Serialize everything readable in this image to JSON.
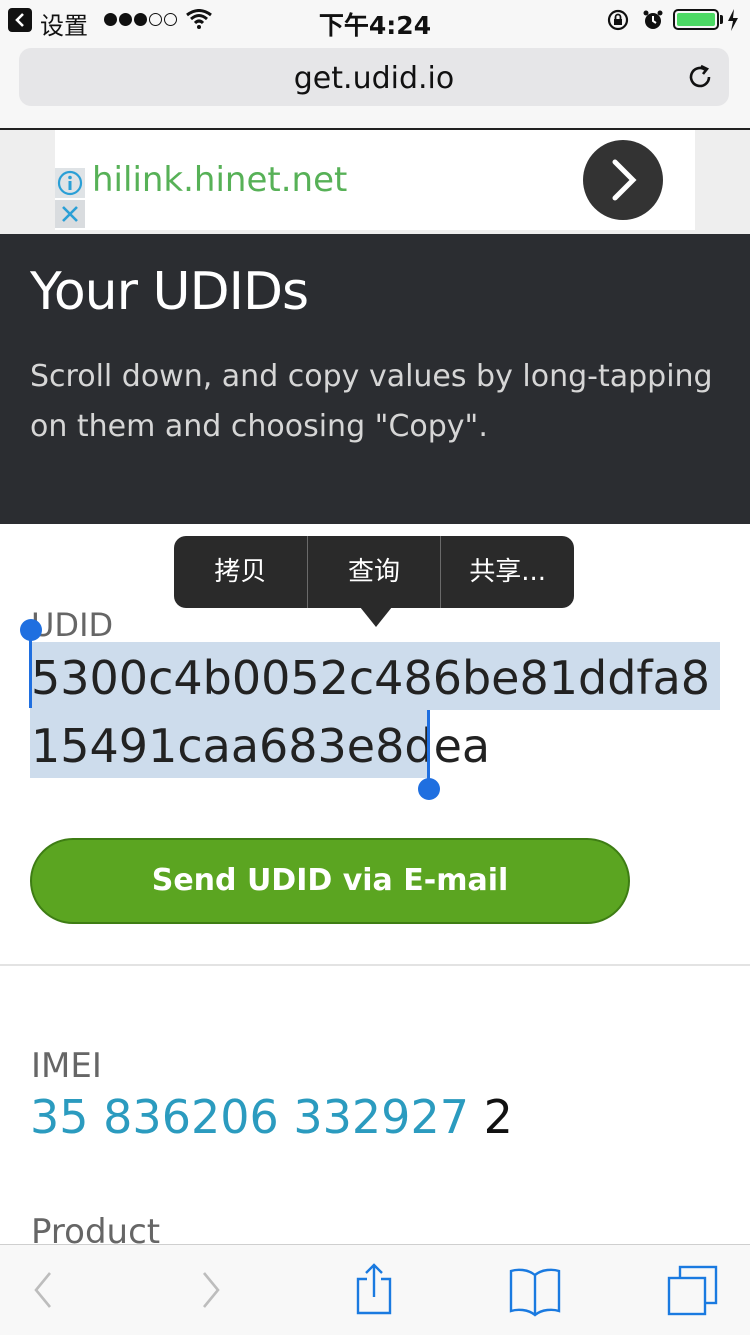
{
  "status_bar": {
    "back_app": "设置",
    "time": "下午4:24"
  },
  "browser": {
    "url": "get.udid.io"
  },
  "ad": {
    "domain": "hilink.hinet.net"
  },
  "hero": {
    "title": "Your UDIDs",
    "subtitle": "Scroll down, and copy values by long-tapping on them and choosing \"Copy\"."
  },
  "context_menu": {
    "items": [
      "拷贝",
      "查询",
      "共享..."
    ]
  },
  "udid": {
    "label": "UDID",
    "value": "5300c4b0052c486be81ddfa815491caa683e8dea"
  },
  "send_button": {
    "label": "Send UDID via E-mail"
  },
  "imei": {
    "label": "IMEI",
    "value_main": "35 836206 332927",
    "value_check": "2"
  },
  "product": {
    "label": "Product"
  },
  "colors": {
    "hero_bg": "#2b2d31",
    "button_green": "#5ba521",
    "link_blue": "#2b9bbf",
    "selection": "#cddcec",
    "selection_handle": "#1f6fe0",
    "battery_green": "#4cd964"
  },
  "icons": {
    "back": "chevron-left-icon",
    "signal": "signal-dots-icon",
    "wifi": "wifi-icon",
    "orientation_lock": "orientation-lock-icon",
    "alarm": "alarm-icon",
    "battery": "battery-icon",
    "charging": "charging-bolt-icon",
    "reload": "reload-icon",
    "ad_info": "info-icon",
    "ad_close": "close-icon",
    "ad_arrow": "chevron-right-icon",
    "toolbar_back": "back-arrow-icon",
    "toolbar_forward": "forward-arrow-icon",
    "toolbar_share": "share-icon",
    "toolbar_bookmarks": "bookmarks-icon",
    "toolbar_tabs": "tabs-icon"
  }
}
